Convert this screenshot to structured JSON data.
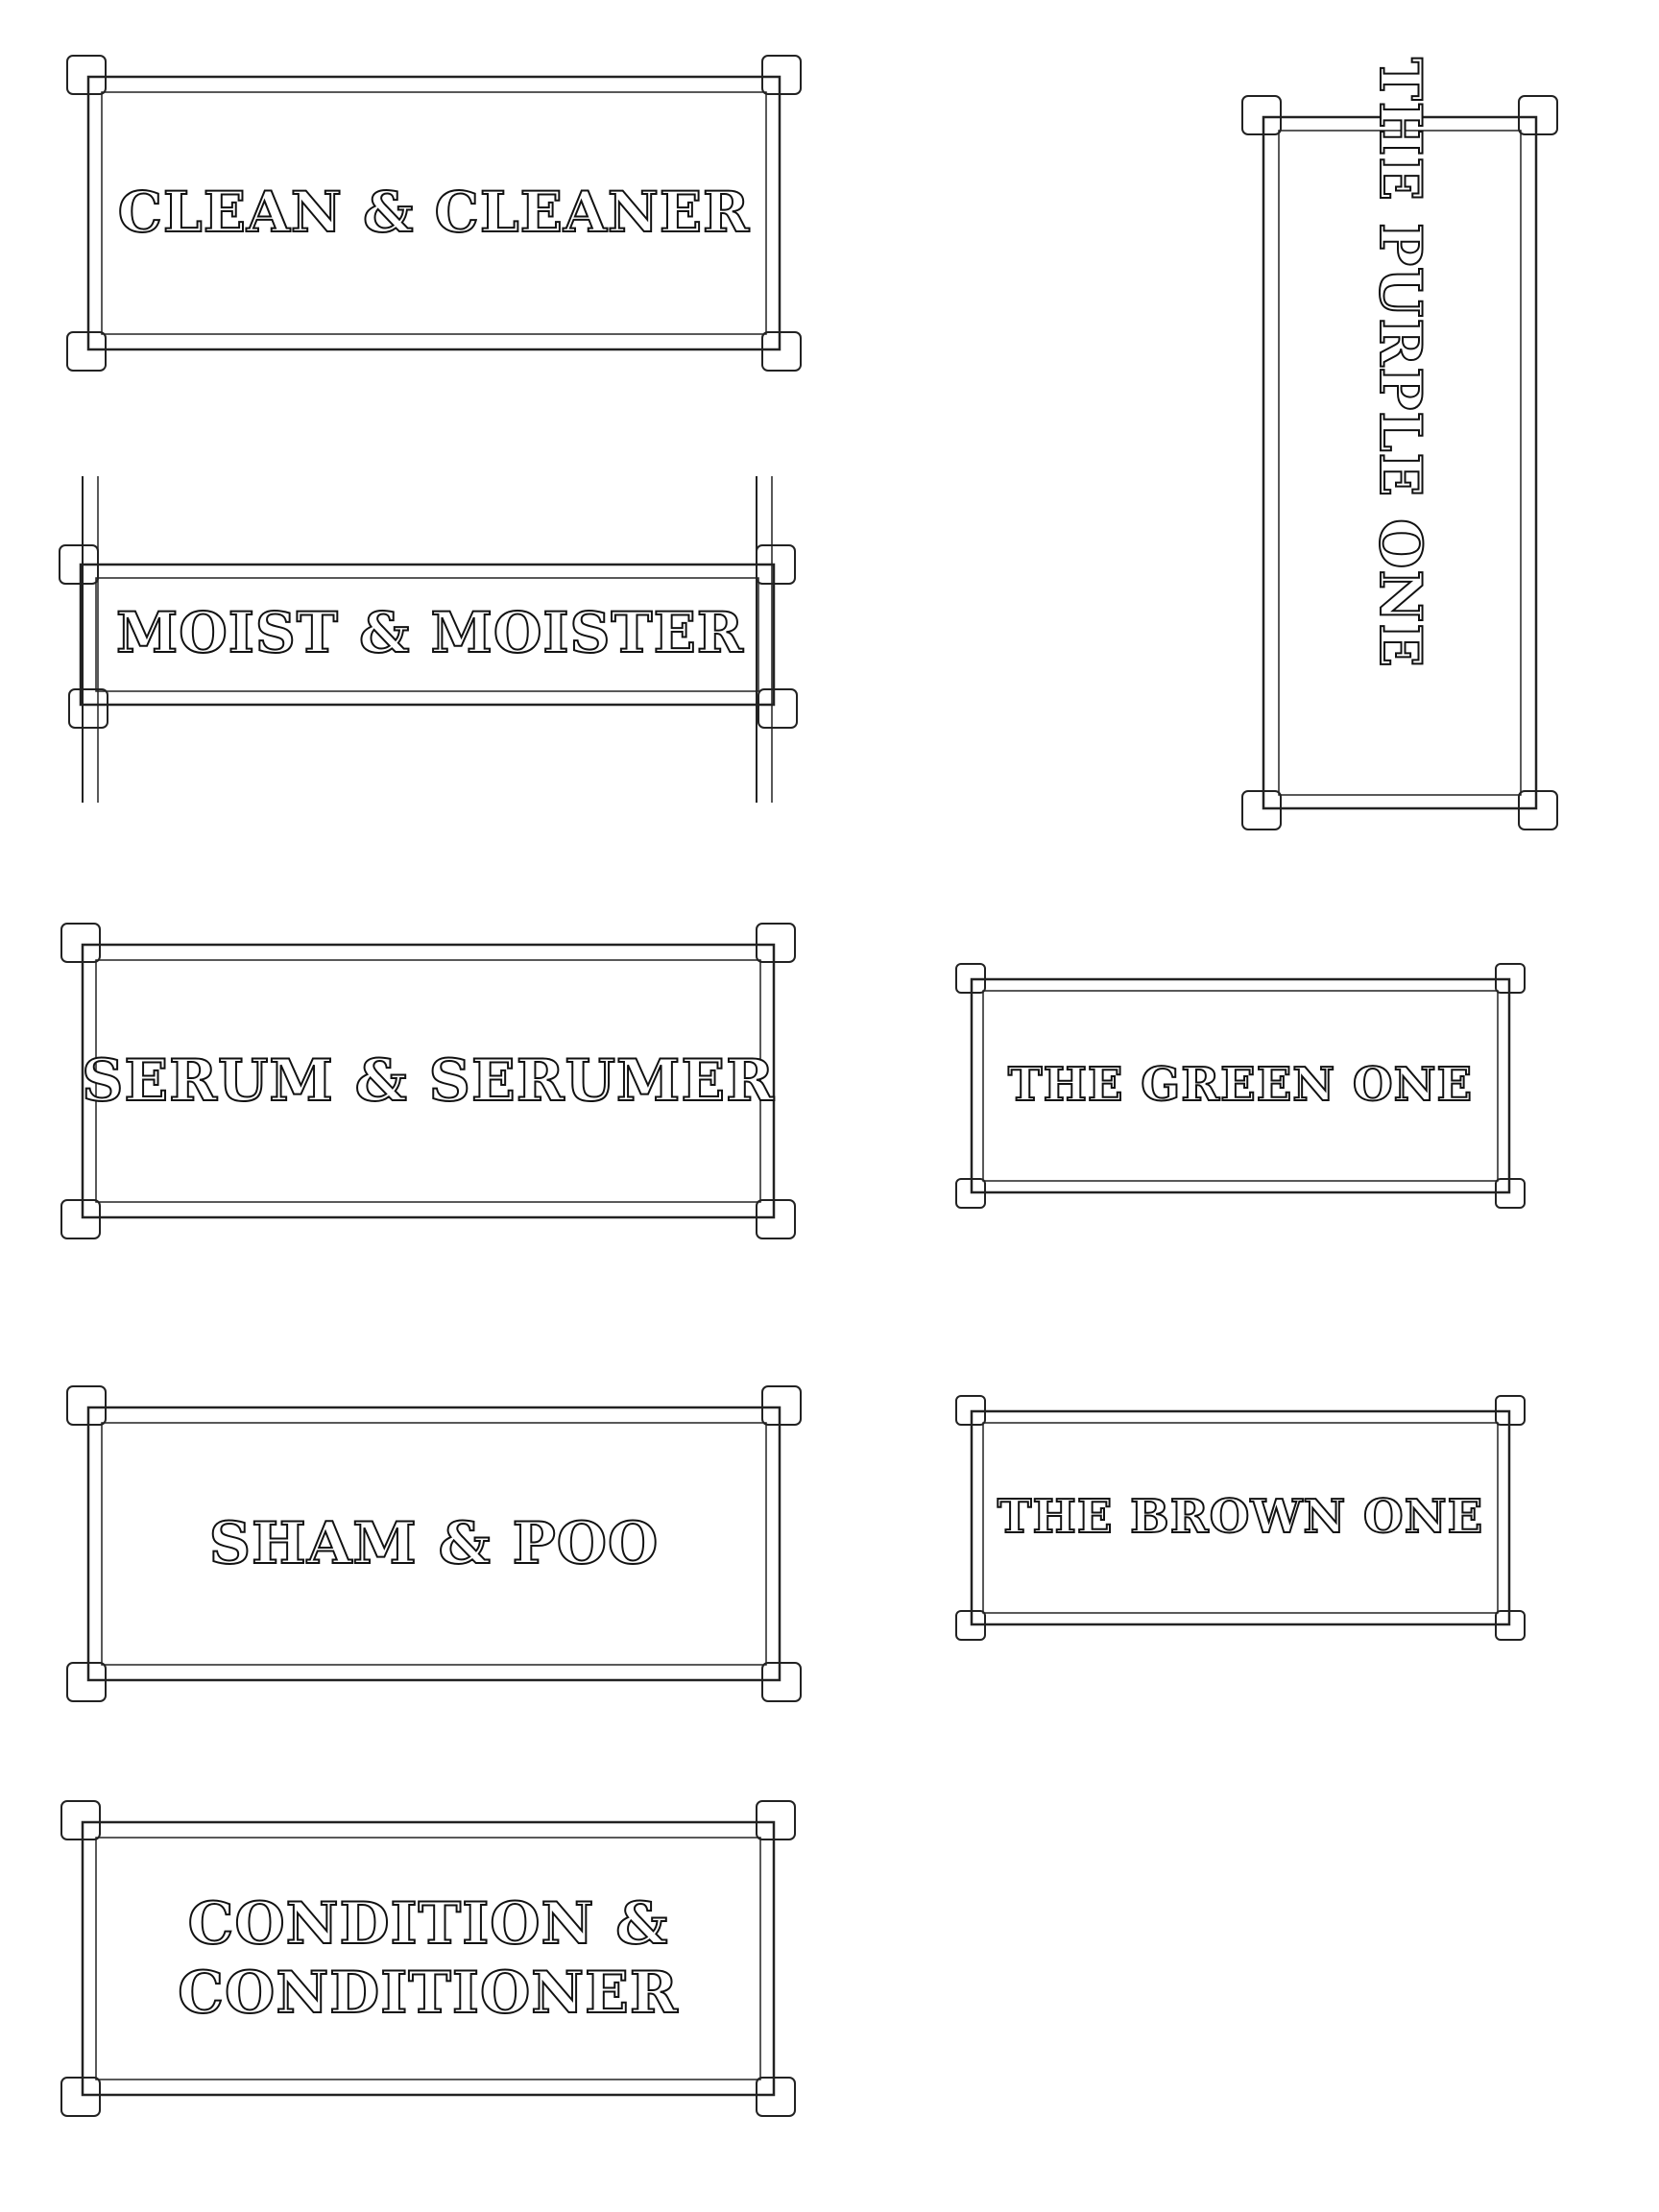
{
  "labels": [
    {
      "id": "clean",
      "text": "CLEAN & CLEANER"
    },
    {
      "id": "moist",
      "text": "MOIST & MOISTER"
    },
    {
      "id": "serum",
      "text": "SERUM & SERUMER"
    },
    {
      "id": "sham",
      "text": "SHAM & POO"
    },
    {
      "id": "condition",
      "text": "CONDITION & CONDITIONER",
      "lines": [
        "CONDITION &",
        "CONDITIONER"
      ]
    },
    {
      "id": "purple",
      "text": "THE PURPLE ONE"
    },
    {
      "id": "green",
      "text": "THE GREEN ONE"
    },
    {
      "id": "brown",
      "text": "THE BROWN ONE"
    }
  ],
  "style": {
    "line_color": "#222222",
    "background": "#ffffff"
  }
}
